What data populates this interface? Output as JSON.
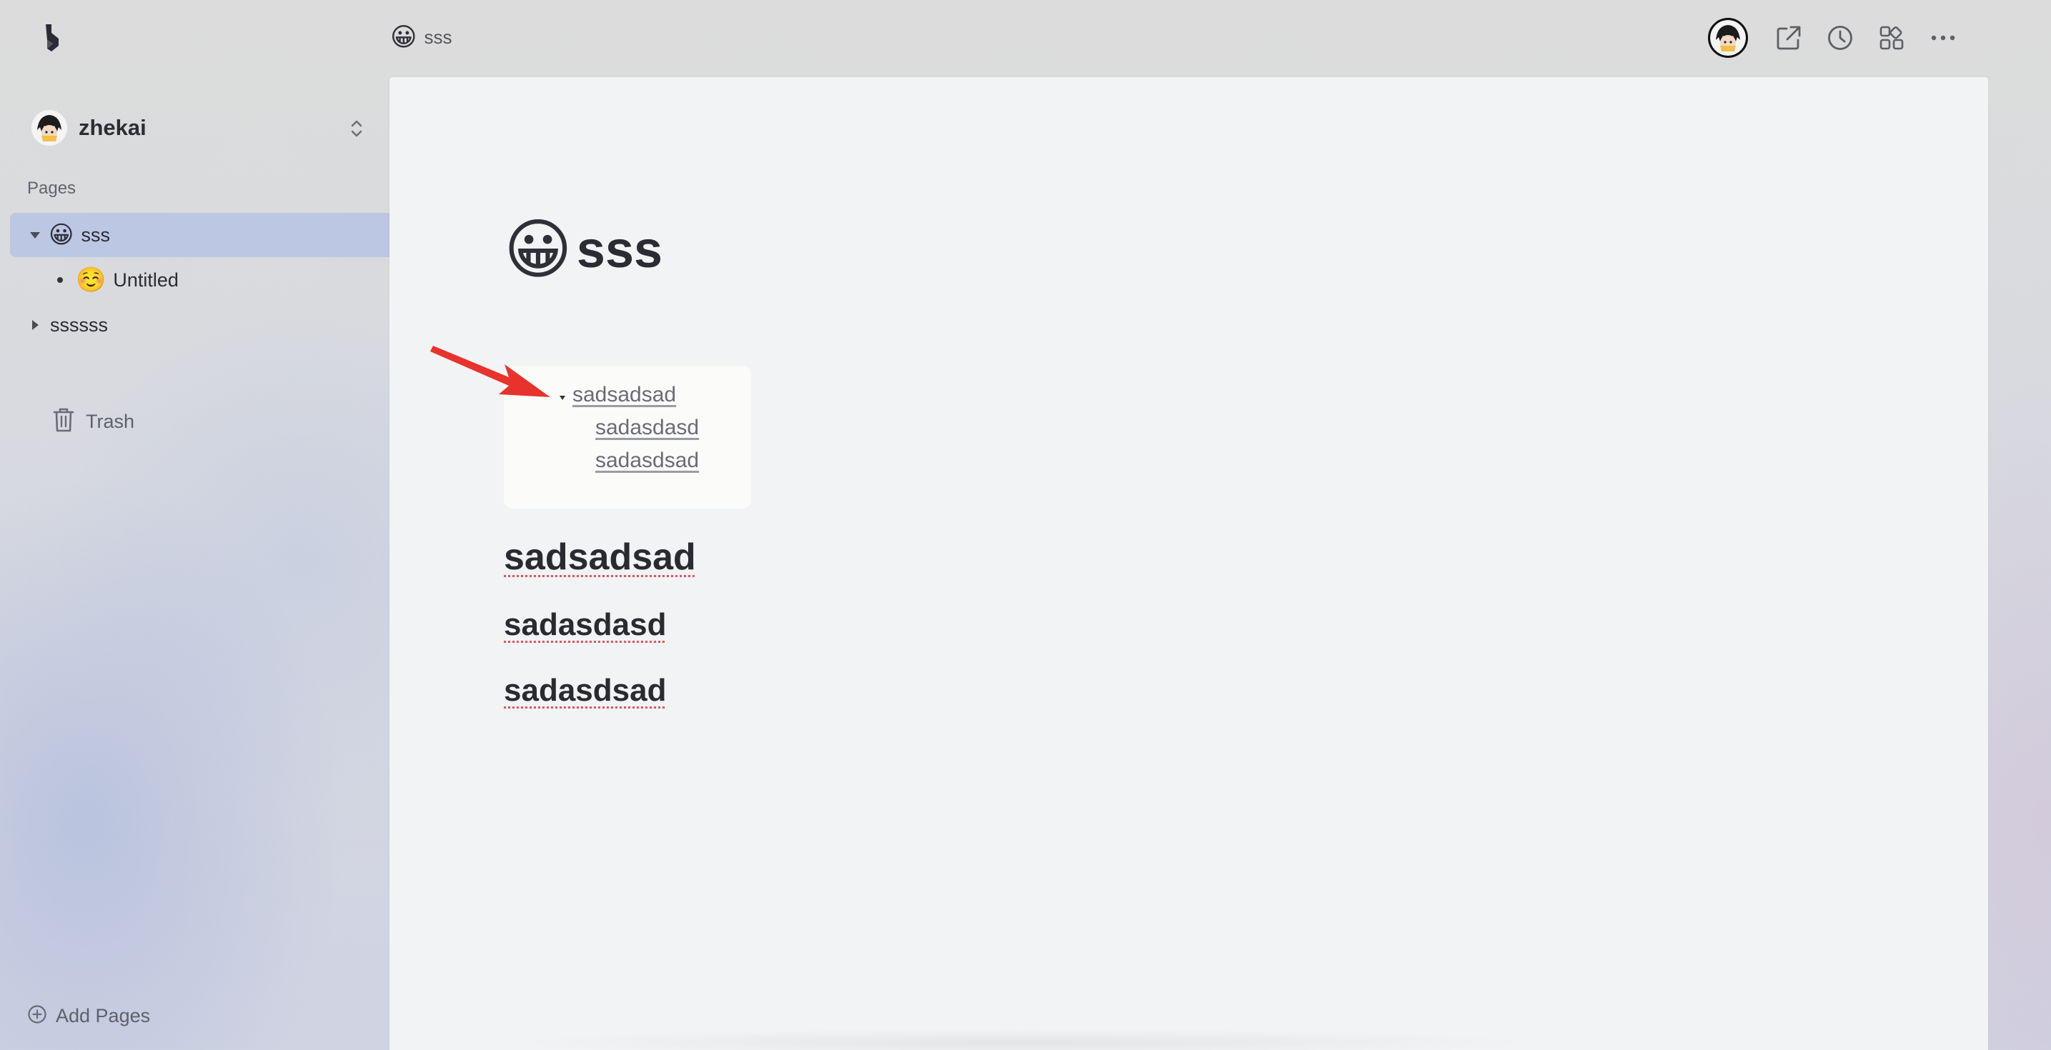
{
  "header": {
    "breadcrumb": {
      "emoji": "😀",
      "label": "sss"
    },
    "icons": {
      "logo": "app-logo-icon",
      "avatar": "user-avatar",
      "open_external": "open-external-icon",
      "history": "clock-icon",
      "apps": "grid-icon",
      "more": "more-horizontal-icon"
    }
  },
  "sidebar": {
    "workspace": {
      "name": "zhekai",
      "switch_icon": "chevron-up-down-icon"
    },
    "section_label": "Pages",
    "pages": [
      {
        "emoji": "😀",
        "label": "sss",
        "expanded": true,
        "active": true
      },
      {
        "emoji": "☺️",
        "label": "Untitled",
        "child": true
      },
      {
        "emoji": "",
        "label": "ssssss",
        "expanded": false
      }
    ],
    "trash": {
      "label": "Trash",
      "icon": "trash-icon"
    },
    "add_pages": {
      "label": "Add Pages",
      "icon": "plus-circle-icon"
    }
  },
  "document": {
    "title": {
      "emoji": "😀",
      "text": "sss"
    },
    "toc": {
      "items": [
        "sadsadsad",
        "sadasdasd",
        "sadasdsad"
      ]
    },
    "headings": [
      "sadsadsad",
      "sadasdasd",
      "sadasdsad"
    ]
  },
  "annotation": {
    "arrow_color": "#e8322c"
  }
}
